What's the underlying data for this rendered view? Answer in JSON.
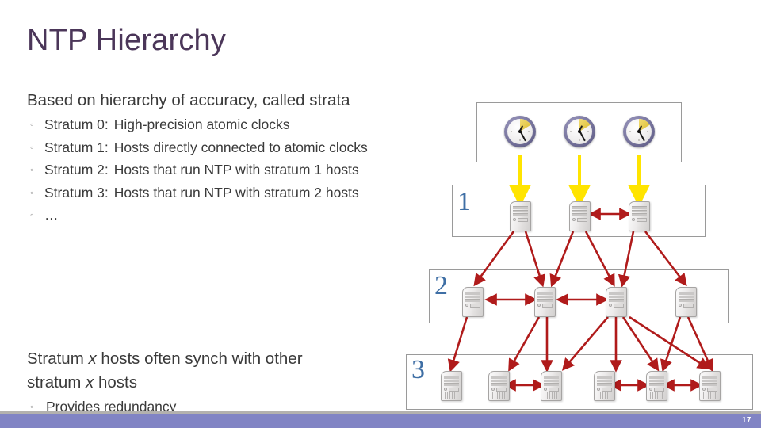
{
  "slide": {
    "title": "NTP Hierarchy",
    "page_number": "17",
    "accent_title_color": "#4B3659",
    "footer_bar_color": "#8184C4",
    "stratum_number_color": "#3F6FA5",
    "downlink_arrow_color": "#FFE400",
    "peer_arrow_color": "#B01B1B"
  },
  "body": {
    "lead": "Based on hierarchy of accuracy, called strata",
    "bullets": [
      {
        "bullet": "◦",
        "label": "Stratum 0:",
        "text": "High-precision atomic clocks"
      },
      {
        "bullet": "◦",
        "label": "Stratum 1:",
        "text": "Hosts directly connected to atomic clocks"
      },
      {
        "bullet": "◦",
        "label": "Stratum 2:",
        "text": "Hosts that run NTP with stratum 1 hosts"
      },
      {
        "bullet": "◦",
        "label": "Stratum 3:",
        "text": "Hosts that run NTP with stratum 2 hosts"
      },
      {
        "bullet": "◦",
        "label": "",
        "text": "…"
      }
    ],
    "closing": {
      "line_a_pre": "Stratum ",
      "line_a_ital": "x",
      "line_a_post": " hosts often synch with other",
      "line_b_pre": "stratum ",
      "line_b_ital": "x",
      "line_b_post": " hosts",
      "sub_bullet": "◦",
      "sub_text": "Provides redundancy"
    }
  },
  "diagram": {
    "clock_box_label": "",
    "clocks": [
      {
        "name": "atomic-clock-1"
      },
      {
        "name": "atomic-clock-2"
      },
      {
        "name": "atomic-clock-3"
      }
    ],
    "strata": [
      {
        "number": "1",
        "host_count": 3
      },
      {
        "number": "2",
        "host_count": 4
      },
      {
        "number": "3",
        "host_count": 6
      }
    ]
  }
}
